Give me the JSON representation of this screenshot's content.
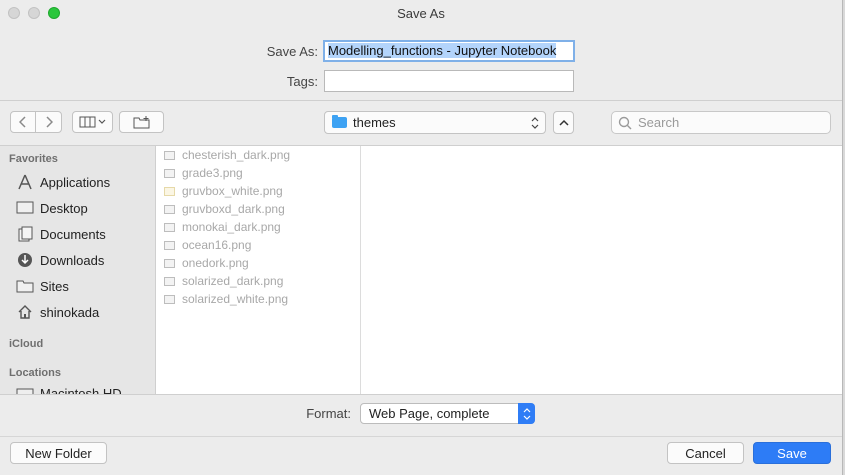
{
  "window": {
    "title": "Save As"
  },
  "save_as": {
    "label": "Save As:",
    "value": "Modelling_functions - Jupyter Notebook"
  },
  "tags": {
    "label": "Tags:",
    "value": ""
  },
  "toolbar": {
    "back_icon": "chevron-left-icon",
    "forward_icon": "chevron-right-icon",
    "view_icon": "columns-view-icon",
    "new_folder_icon": "new-folder-icon",
    "location": "themes",
    "search_placeholder": "Search"
  },
  "sidebar": {
    "favorites_heading": "Favorites",
    "items": [
      {
        "label": "Applications",
        "icon": "applications-icon"
      },
      {
        "label": "Desktop",
        "icon": "desktop-icon"
      },
      {
        "label": "Documents",
        "icon": "documents-icon"
      },
      {
        "label": "Downloads",
        "icon": "downloads-icon"
      },
      {
        "label": "Sites",
        "icon": "folder-icon"
      },
      {
        "label": "shinokada",
        "icon": "home-icon"
      }
    ],
    "icloud_heading": "iCloud",
    "locations_heading": "Locations",
    "locations_items": [
      {
        "label": "Macintosh HD"
      }
    ]
  },
  "files": [
    "chesterish_dark.png",
    "grade3.png",
    "gruvbox_white.png",
    "gruvboxd_dark.png",
    "monokai_dark.png",
    "ocean16.png",
    "onedork.png",
    "solarized_dark.png",
    "solarized_white.png"
  ],
  "format": {
    "label": "Format:",
    "value": "Web Page, complete"
  },
  "buttons": {
    "new_folder": "New Folder",
    "cancel": "Cancel",
    "save": "Save"
  },
  "colors": {
    "accent": "#2d7cf6",
    "folder": "#3da2f3"
  }
}
